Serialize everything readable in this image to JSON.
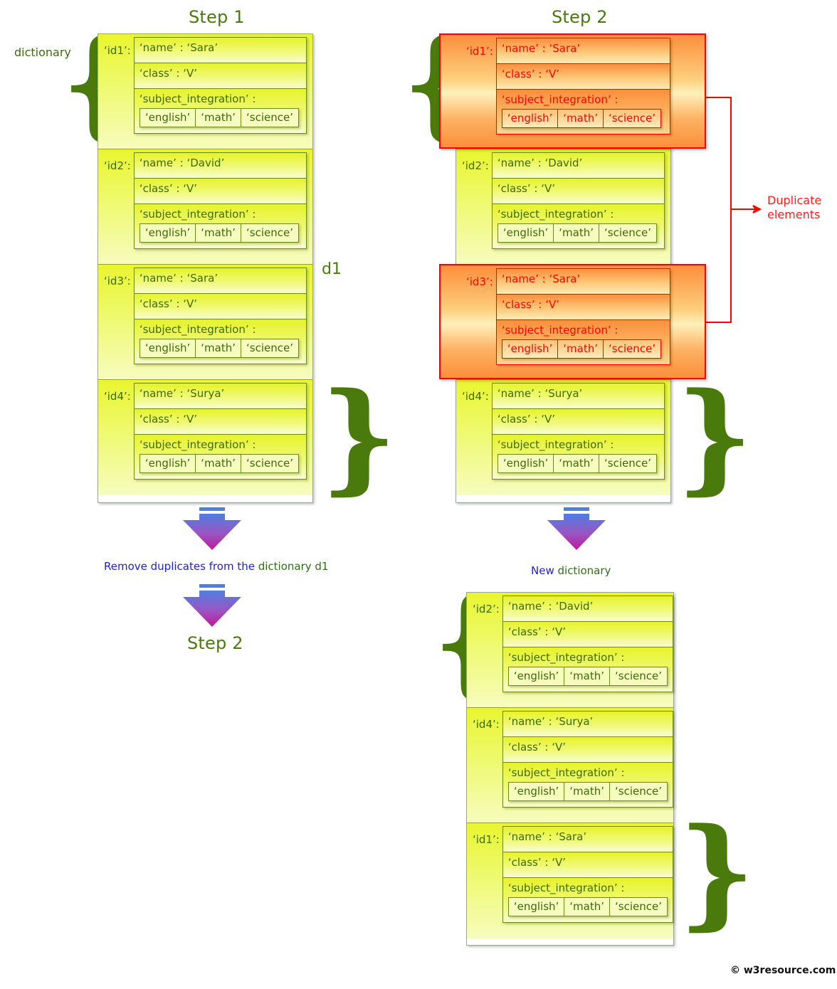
{
  "footer": {
    "text": "© w3resource.com"
  },
  "step1": {
    "title": "Step 1",
    "side_label": "dictionary",
    "name_label": "d1",
    "entries": [
      {
        "key": "‘id1’:",
        "name": "‘name’ : ‘Sara’",
        "class": "‘class’ : ‘V’",
        "subject_label": "‘subject_integration’ :",
        "subjects": [
          "‘english’",
          "‘math’",
          "‘science’"
        ]
      },
      {
        "key": "‘id2’:",
        "name": "‘name’ : ‘David’",
        "class": "‘class’ : ‘V’",
        "subject_label": "‘subject_integration’ :",
        "subjects": [
          "‘english’",
          "‘math’",
          "‘science’"
        ]
      },
      {
        "key": "‘id3’:",
        "name": "‘name’ : ‘Sara’",
        "class": "‘class’ : ‘V’",
        "subject_label": "‘subject_integration’ :",
        "subjects": [
          "‘english’",
          "‘math’",
          "‘science’"
        ]
      },
      {
        "key": "‘id4’:",
        "name": "‘name’ : ‘Surya’",
        "class": "‘class’ : ‘V’",
        "subject_label": "‘subject_integration’ :",
        "subjects": [
          "‘english’",
          "‘math’",
          "‘science’"
        ]
      }
    ]
  },
  "step2": {
    "title": "Step 2",
    "duplicate_label_line1": "Duplicate",
    "duplicate_label_line2": "elements",
    "entries": [
      {
        "key": "‘id1’:",
        "name": "‘name’ : ‘Sara’",
        "class": "‘class’ : ‘V’",
        "subject_label": "‘subject_integration’ :",
        "subjects": [
          "‘english’",
          "‘math’",
          "‘science’"
        ],
        "duplicate": true
      },
      {
        "key": "‘id2’:",
        "name": "‘name’ : ‘David’",
        "class": "‘class’ : ‘V’",
        "subject_label": "‘subject_integration’ :",
        "subjects": [
          "‘english’",
          "‘math’",
          "‘science’"
        ],
        "duplicate": false
      },
      {
        "key": "‘id3’:",
        "name": "‘name’ : ‘Sara’",
        "class": "‘class’ : ‘V’",
        "subject_label": "‘subject_integration’ :",
        "subjects": [
          "‘english’",
          "‘math’",
          "‘science’"
        ],
        "duplicate": true
      },
      {
        "key": "‘id4’:",
        "name": "‘name’ : ‘Surya’",
        "class": "‘class’ : ‘V’",
        "subject_label": "‘subject_integration’ :",
        "subjects": [
          "‘english’",
          "‘math’",
          "‘science’"
        ],
        "duplicate": false
      }
    ]
  },
  "flow_left": {
    "caption_blue": "Remove duplicates from the ",
    "caption_green": "dictionary d1",
    "result_title": "Step 2"
  },
  "flow_right": {
    "caption_blue": "New ",
    "caption_green": "dictionary"
  },
  "result": {
    "entries": [
      {
        "key": "‘id2’:",
        "name": "‘name’ : ‘David’",
        "class": "‘class’ : ‘V’",
        "subject_label": "‘subject_integration’ :",
        "subjects": [
          "‘english’",
          "‘math’",
          "‘science’"
        ]
      },
      {
        "key": "‘id4’:",
        "name": "‘name’ : ‘Surya’",
        "class": "‘class’ : ‘V’",
        "subject_label": "‘subject_integration’ :",
        "subjects": [
          "‘english’",
          "‘math’",
          "‘science’"
        ]
      },
      {
        "key": "‘id1’:",
        "name": "‘name’ : ‘Sara’",
        "class": "‘class’ : ‘V’",
        "subject_label": "‘subject_integration’ :",
        "subjects": [
          "‘english’",
          "‘math’",
          "‘science’"
        ]
      }
    ]
  },
  "colors": {
    "green_text": "#3e6b0a",
    "brace_green": "#4a7a0b",
    "yellow_light": "#f6fcbe",
    "yellow": "#e9f52e",
    "orange": "#fb8f3c",
    "red": "#ff0000",
    "blue_text": "#2222cc",
    "arrow_top": "#4f7fe0",
    "arrow_bottom": "#c0179a"
  }
}
